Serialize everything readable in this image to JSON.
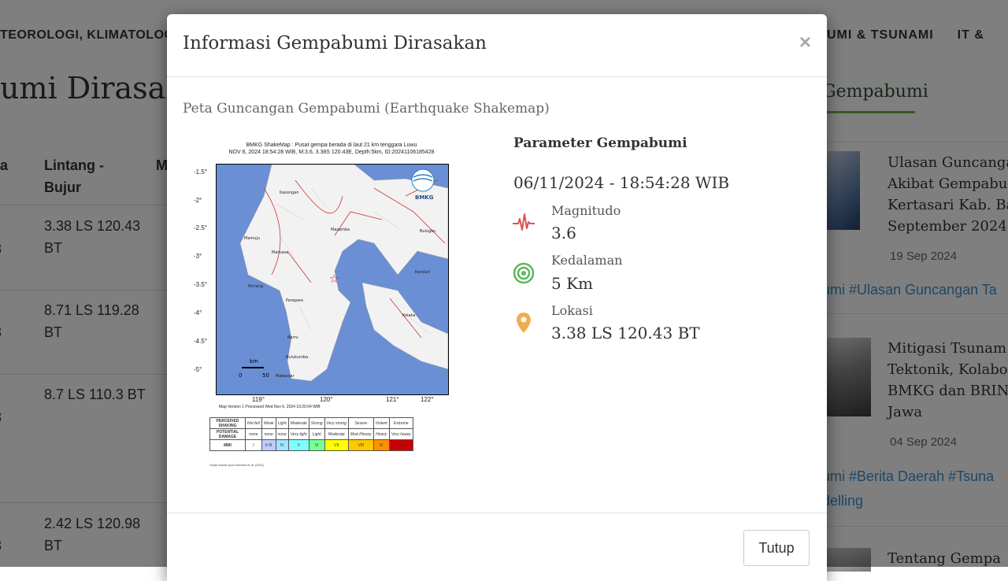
{
  "background": {
    "nav_left": "TEOROLOGI, KLIMATOLOGI",
    "nav_right": [
      "UMI & TSUNAMI",
      "IT &"
    ],
    "page_heading": "umi Dirasakan",
    "side_heading": "Gempabumi",
    "table_headers": {
      "col_a": "a",
      "col_lat": "Lintang - Bujur",
      "col_m": "M"
    },
    "rows": [
      {
        "num": "3",
        "coord": "3.38 LS 120.43 BT"
      },
      {
        "num": "3",
        "coord": "8.71 LS 119.28 BT"
      },
      {
        "num": "3",
        "coord": "8.7 LS 110.3 BT"
      },
      {
        "num": "3",
        "coord": "2.42 LS 120.98 BT"
      }
    ],
    "news": [
      {
        "lines": [
          "Ulasan Guncanga",
          "Akibat Gempabu",
          "Kertasari Kab. Ba",
          "September 2024"
        ],
        "date": "19 Sep 2024",
        "tags": "umi #Ulasan Guncangan Ta"
      },
      {
        "lines": [
          "Mitigasi Tsunam",
          "Tektonik, Kolabo",
          "BMKG dan BRIN",
          "Jawa"
        ],
        "date": "04 Sep 2024",
        "tags": "umi #Berita Daerah #Tsuna",
        "tags2": "delling"
      },
      {
        "lines": [
          "Tentang Gempa"
        ]
      }
    ]
  },
  "modal": {
    "title": "Informasi Gempabumi Dirasakan",
    "close_symbol": "×",
    "map_caption": "Peta Guncangan Gempabumi (Earthquake Shakemap)",
    "map": {
      "header_line1": "BMKG ShakeMap : Pusat gempa berada di laut 21 km tenggara Luwu",
      "header_line2": "NOV 6, 2024 18:54:28 WIB, M:3.6, 3.38S 120.43E, Depth:5km, ID:20241106185428",
      "lat_ticks": [
        "-1.5°",
        "-2°",
        "-2.5°",
        "-3°",
        "-3.5°",
        "-4°",
        "-4.5°",
        "-5°"
      ],
      "lon_ticks": [
        "119°",
        "120°",
        "121°",
        "122°"
      ],
      "cities": [
        "Kasongan",
        "Masamba",
        "Mamuju",
        "Bulugku",
        "Mamasa",
        "Pinrang",
        "Parepare",
        "Kolaka",
        "Barru",
        "Bulukumba",
        "Makassar",
        "Kendari"
      ],
      "scale_label": "km",
      "scale_ticks": [
        "0",
        "50"
      ],
      "logo_text": "BMKG",
      "version_text": "Map Version 1 Processed Wed Nov 6, 2024 19:20:04 WIB",
      "legend": {
        "row_headers": [
          "PERCEIVED SHAKING",
          "POTENTIAL DAMAGE",
          "MMI"
        ],
        "shaking": [
          "Not felt",
          "Weak",
          "Light",
          "Moderate",
          "Strong",
          "Very strong",
          "Severe",
          "Violent",
          "Extreme"
        ],
        "damage": [
          "none",
          "none",
          "none",
          "Very light",
          "Light",
          "Moderate",
          "Mod./Heavy",
          "Heavy",
          "Very heavy"
        ],
        "mmi": [
          "I",
          "II-III",
          "IV",
          "V",
          "VI",
          "VII",
          "VIII",
          "IX",
          "X+"
        ],
        "mmi_colors": [
          "#ffffff",
          "#bfccff",
          "#a0e6ff",
          "#80ffff",
          "#7aff93",
          "#ffff00",
          "#ffc800",
          "#ff9100",
          "#ff0000",
          "#c80000"
        ]
      },
      "scale_note": "Scale based upon Worden et al. (2011)"
    },
    "params": {
      "title": "Parameter Gempabumi",
      "datetime": "06/11/2024 - 18:54:28 WIB",
      "items": [
        {
          "icon": "seismograph-icon",
          "label": "Magnitudo",
          "value": "3.6",
          "color": "#d9534f"
        },
        {
          "icon": "depth-icon",
          "label": "Kedalaman",
          "value": "5 Km",
          "color": "#5cb85c"
        },
        {
          "icon": "location-pin-icon",
          "label": "Lokasi",
          "value": "3.38 LS 120.43 BT",
          "color": "#f0ad4e"
        }
      ]
    },
    "close_button": "Tutup"
  }
}
